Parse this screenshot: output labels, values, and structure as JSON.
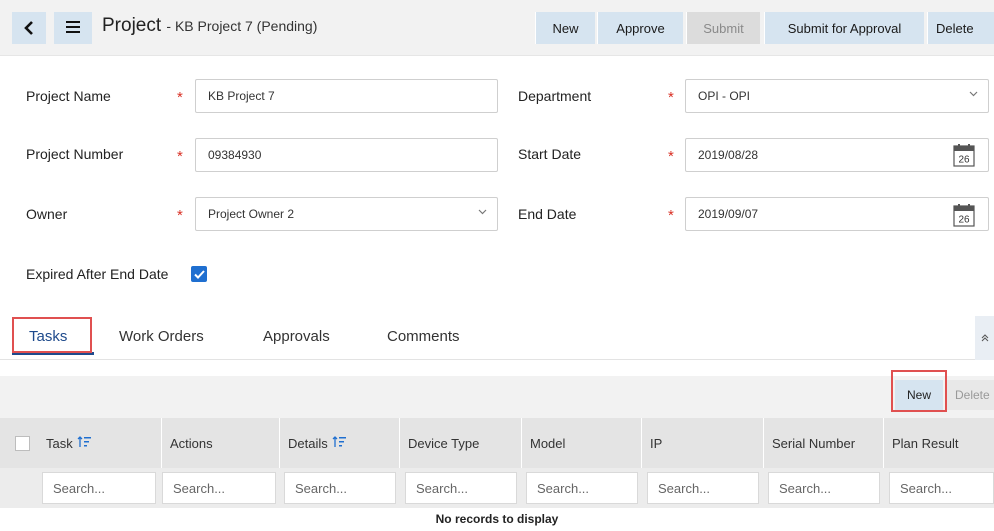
{
  "header": {
    "back_icon": "‹",
    "menu_icon": "≡",
    "title": "Project",
    "subtitle": "- KB Project 7 (Pending)",
    "actions": [
      {
        "label": "New",
        "disabled": false
      },
      {
        "label": "Approve",
        "disabled": false
      },
      {
        "label": "Submit",
        "disabled": true
      },
      {
        "label": "Submit for Approval",
        "disabled": false
      },
      {
        "label": "Delete",
        "disabled": false
      }
    ]
  },
  "form": {
    "project_name": {
      "label": "Project Name",
      "value": "KB Project 7",
      "required": "*"
    },
    "project_number": {
      "label": "Project Number",
      "value": "09384930",
      "required": "*"
    },
    "owner": {
      "label": "Owner",
      "value": "Project Owner 2",
      "required": "*"
    },
    "department": {
      "label": "Department",
      "value": "OPI - OPI",
      "required": "*"
    },
    "start_date": {
      "label": "Start Date",
      "value": "2019/08/28",
      "required": "*",
      "calendar_day": "26"
    },
    "end_date": {
      "label": "End Date",
      "value": "2019/09/07",
      "required": "*",
      "calendar_day": "26"
    },
    "expired_after_end_date": {
      "label": "Expired After End Date",
      "checked": true
    }
  },
  "tabs": [
    {
      "label": "Tasks",
      "active": true
    },
    {
      "label": "Work Orders",
      "active": false
    },
    {
      "label": "Approvals",
      "active": false
    },
    {
      "label": "Comments",
      "active": false
    }
  ],
  "grid": {
    "toolbar": {
      "new_label": "New",
      "delete_label": "Delete"
    },
    "columns": [
      "Task",
      "Actions",
      "Details",
      "Device Type",
      "Model",
      "IP",
      "Serial Number",
      "Plan Result"
    ],
    "search_placeholder": "Search...",
    "empty_message": "No records to display"
  },
  "colors": {
    "accent": "#1e4a8c",
    "button_bg": "#d6e4f0",
    "highlight": "#e05050",
    "required": "#d93025"
  }
}
